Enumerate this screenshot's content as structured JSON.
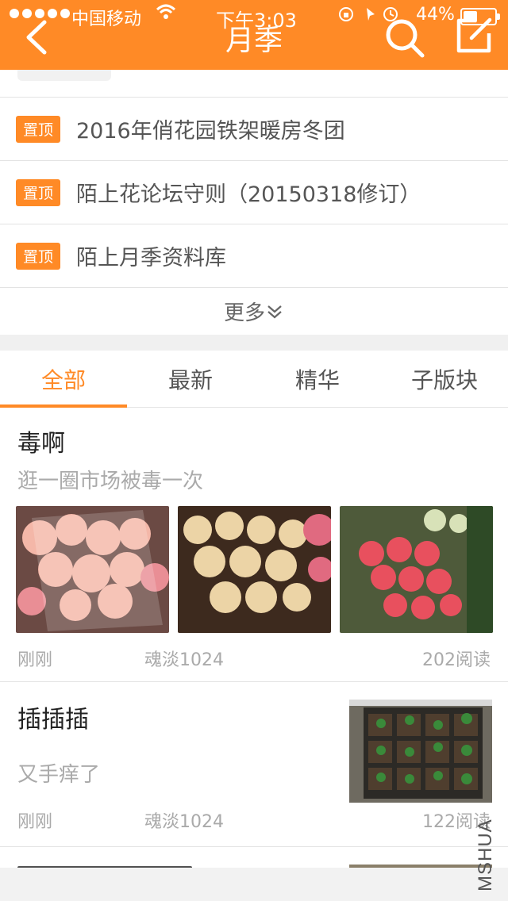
{
  "status_bar": {
    "carrier": "中国移动",
    "time": "下午3:03",
    "battery": "44%",
    "battery_level": 0.44
  },
  "header": {
    "title": "月季",
    "back_icon": "chevron-left-icon",
    "search_icon": "search-icon",
    "edit_icon": "edit-icon"
  },
  "pinned": {
    "tag": "置顶",
    "items": [
      {
        "title": "2016年俏花园铁架暖房冬团"
      },
      {
        "title": "陌上花论坛守则（20150318修订）"
      },
      {
        "title": "陌上月季资料库"
      }
    ],
    "more_label": "更多"
  },
  "tabs": [
    {
      "label": "全部",
      "active": true
    },
    {
      "label": "最新",
      "active": false
    },
    {
      "label": "精华",
      "active": false
    },
    {
      "label": "子版块",
      "active": false
    }
  ],
  "posts": [
    {
      "title": "毒啊",
      "subtitle": "逛一圈市场被毒一次",
      "time": "刚刚",
      "author": "魂淡1024",
      "reads": "202阅读"
    },
    {
      "title": "插插插",
      "subtitle": "又手痒了",
      "time": "刚刚",
      "author": "魂淡1024",
      "reads": "122阅读"
    }
  ],
  "watermark": "MSHUA",
  "colors": {
    "accent": "#ff8a26",
    "text_primary": "#222222",
    "text_secondary": "#aaaaaa"
  }
}
